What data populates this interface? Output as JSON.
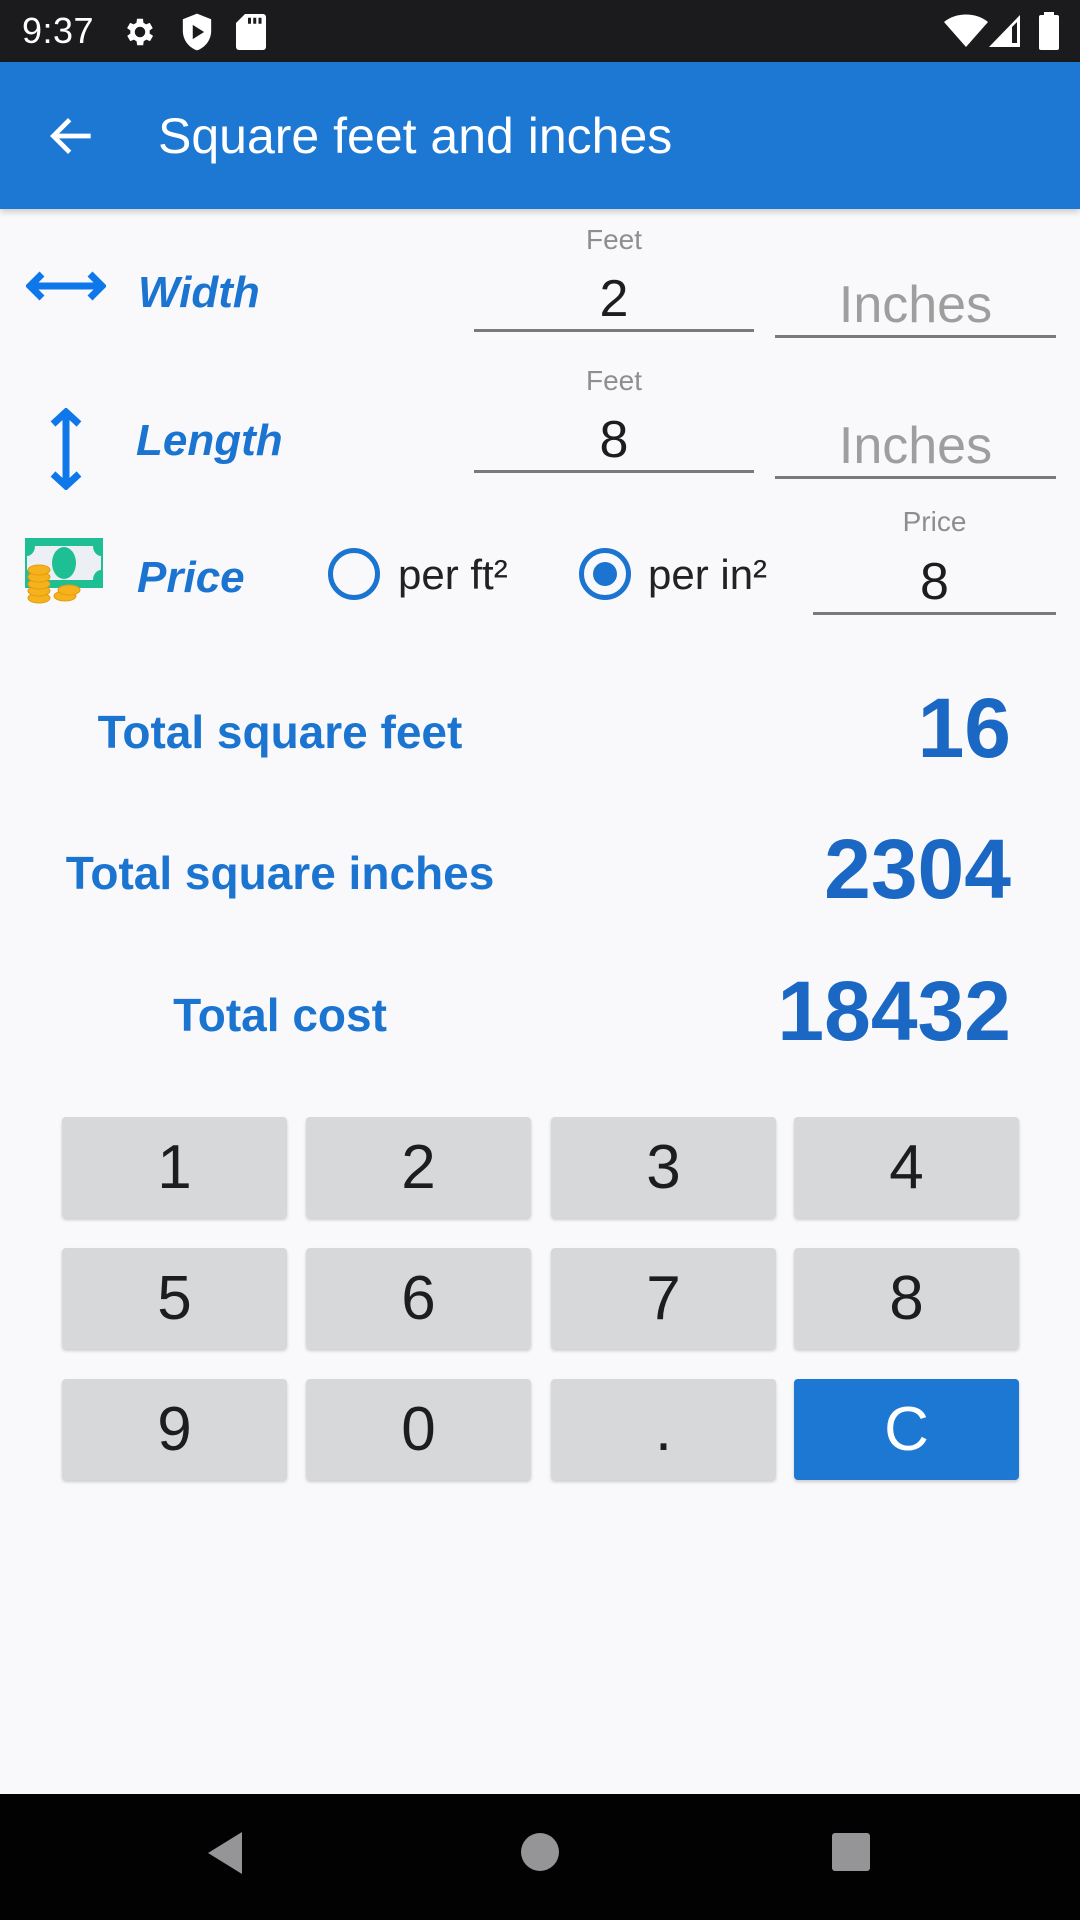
{
  "status_bar": {
    "time": "9:37",
    "left_icons": [
      "gear-icon",
      "shield-play-icon",
      "sd-card-icon"
    ],
    "right_icons": [
      "wifi-icon",
      "cellular-signal-icon",
      "battery-icon"
    ]
  },
  "app_bar": {
    "title": "Square feet and inches",
    "back_icon": "arrow-left-icon"
  },
  "inputs": {
    "width": {
      "label": "Width",
      "icon": "horizontal-arrows-icon",
      "feet_hint": "Feet",
      "feet_value": "2",
      "inches_placeholder": "Inches",
      "inches_value": ""
    },
    "length": {
      "label": "Length",
      "icon": "vertical-arrows-icon",
      "feet_hint": "Feet",
      "feet_value": "8",
      "inches_placeholder": "Inches",
      "inches_value": ""
    },
    "price": {
      "label": "Price",
      "icon": "money-icon",
      "options": [
        {
          "label": "per ft²",
          "checked": false
        },
        {
          "label": "per in²",
          "checked": true
        }
      ],
      "price_hint": "Price",
      "price_value": "8"
    }
  },
  "totals": {
    "square_feet": {
      "label": "Total square feet",
      "value": "16"
    },
    "square_inches": {
      "label": "Total square inches",
      "value": "2304"
    },
    "cost": {
      "label": "Total cost",
      "value": "18432"
    }
  },
  "keypad": {
    "keys": [
      "1",
      "2",
      "3",
      "4",
      "5",
      "6",
      "7",
      "8",
      "9",
      "0",
      ".",
      "C"
    ]
  },
  "nav_bar": {
    "icons": [
      "back-triangle-icon",
      "home-circle-icon",
      "recents-square-icon"
    ]
  },
  "colors": {
    "primary": "#1c78d3",
    "label_blue": "#1c74d1",
    "key_grey": "#d7d8da",
    "background": "#f9f9fb"
  }
}
